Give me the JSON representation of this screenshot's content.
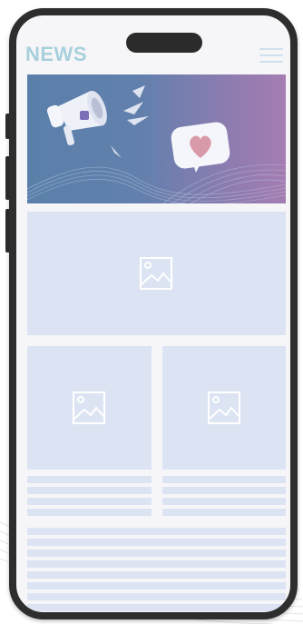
{
  "header": {
    "logo_text": "NEWS",
    "menu_icon": "hamburger-icon"
  },
  "hero": {
    "icons": [
      "megaphone-icon",
      "heart-speech-bubble-icon"
    ],
    "gradient_colors": [
      "#5a80aa",
      "#a57db2"
    ]
  },
  "placeholders": {
    "image_icon": "image-placeholder-icon",
    "card_color": "#dce4f3"
  },
  "colors": {
    "logo": "#a7d0dc",
    "phone_frame": "#2e2e2e",
    "screen_bg": "#f6f6f8"
  }
}
